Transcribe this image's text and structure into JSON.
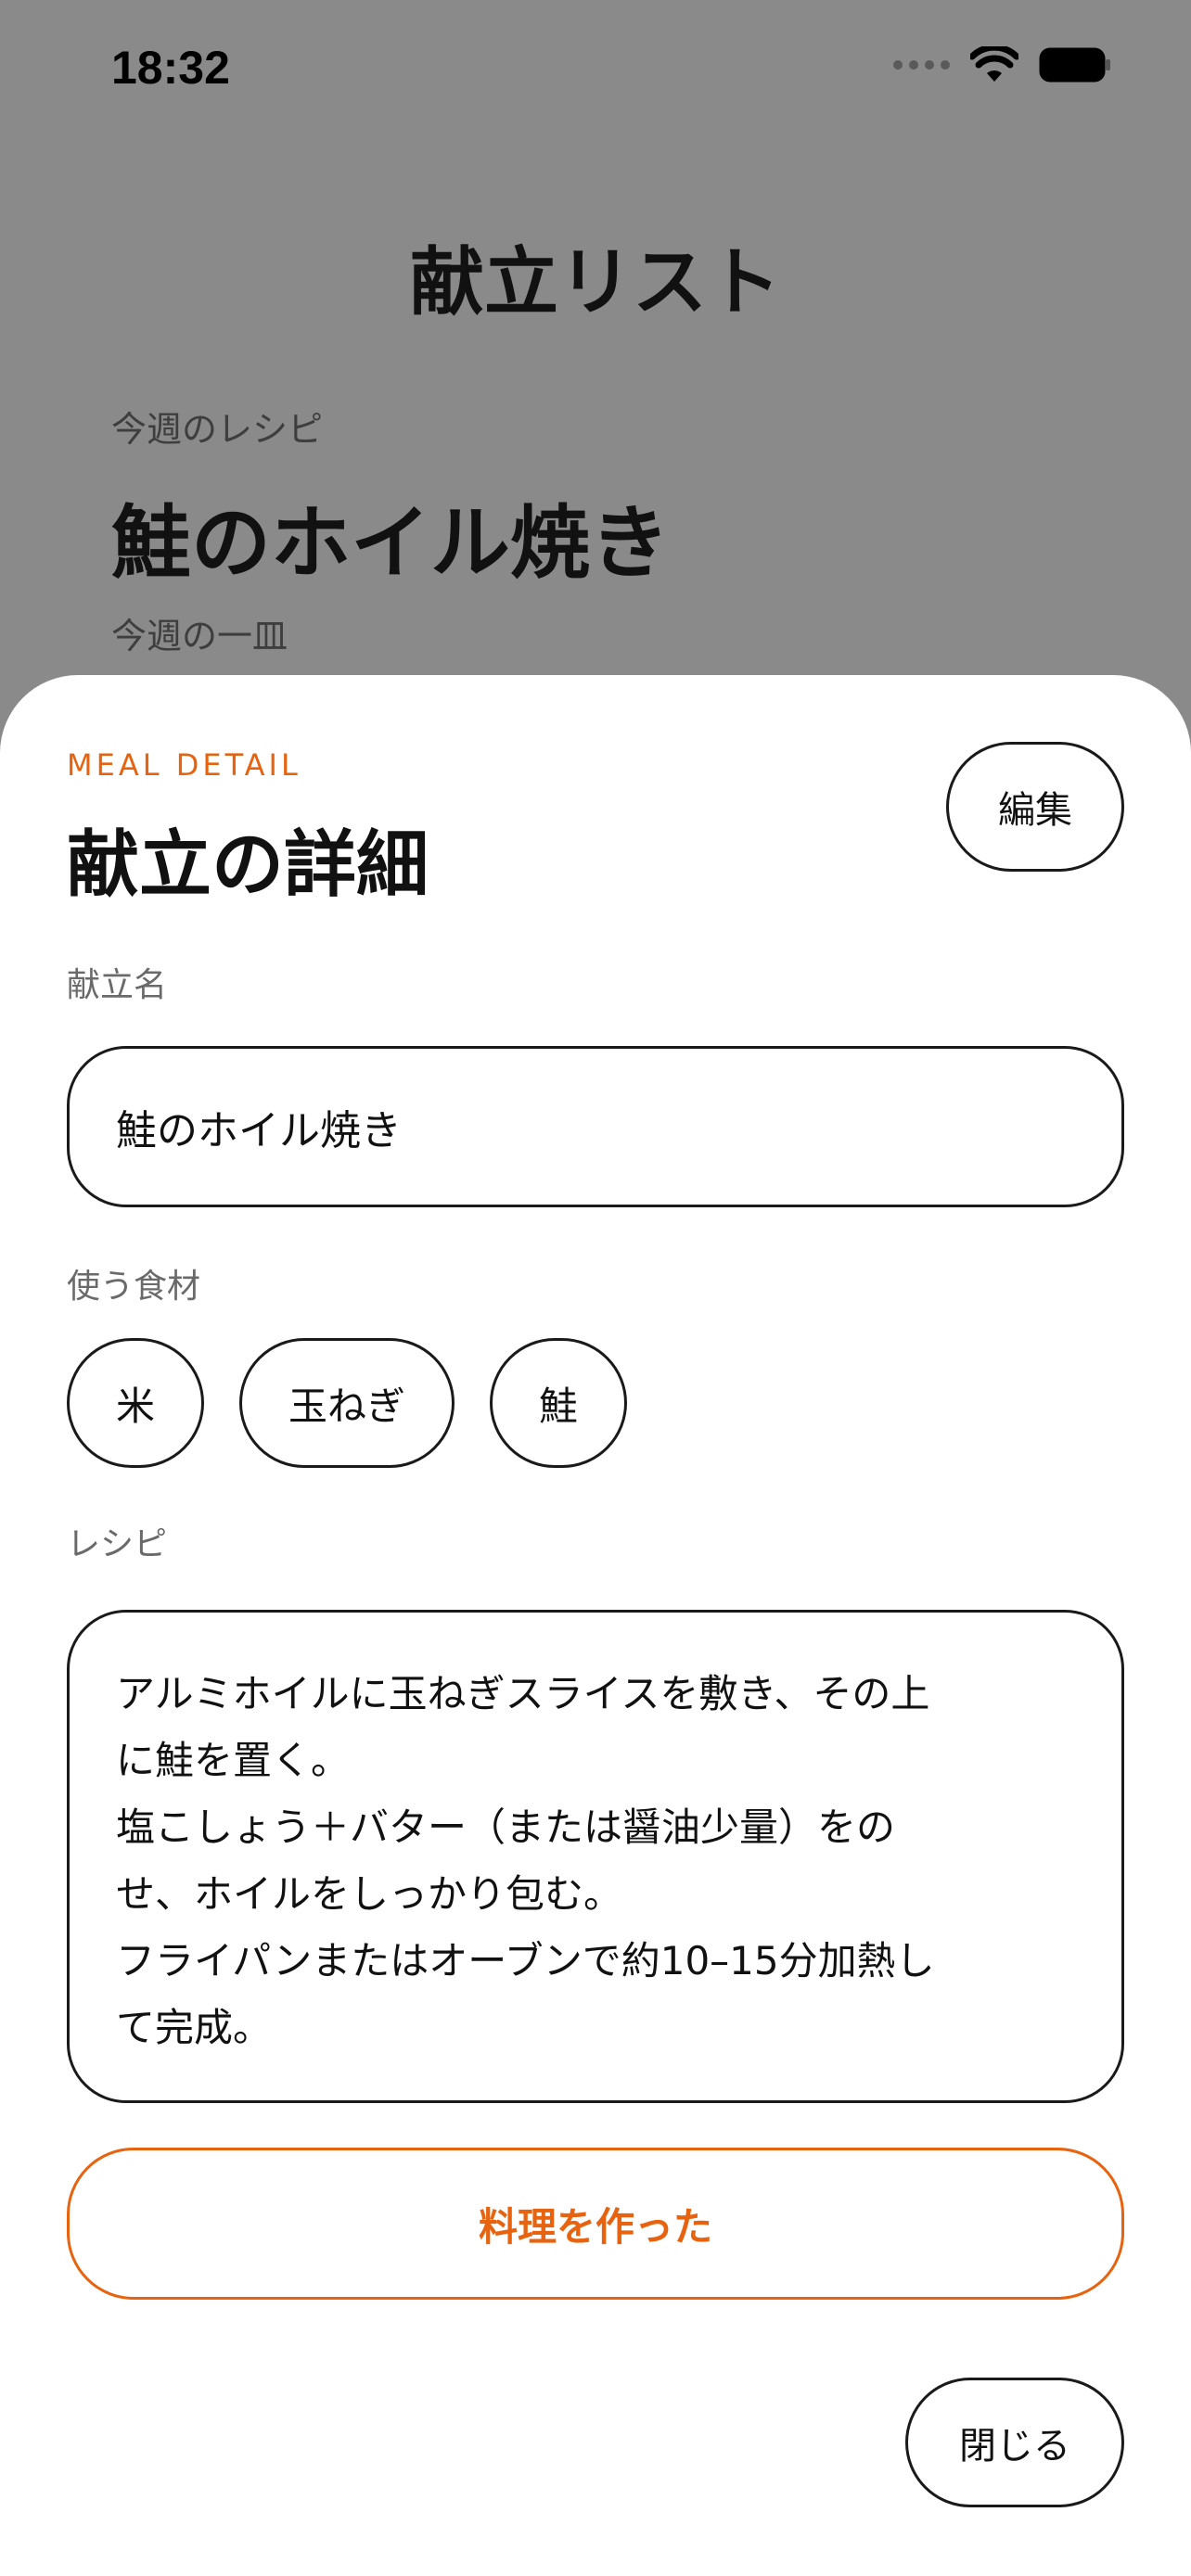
{
  "status_bar": {
    "time": "18:32"
  },
  "background_page": {
    "title": "献立リスト",
    "section_label": "今週のレシピ",
    "dish_name": "鮭のホイル焼き",
    "sub_label": "今週の一皿"
  },
  "sheet": {
    "eyebrow": "MEAL DETAIL",
    "title": "献立の詳細",
    "edit_label": "編集",
    "name_label": "献立名",
    "name_value": "鮭のホイル焼き",
    "ingredients_label": "使う食材",
    "ingredients": [
      "米",
      "玉ねぎ",
      "鮭"
    ],
    "recipe_label": "レシピ",
    "recipe_lines": [
      "アルミホイルに玉ねぎスライスを敷き、その上",
      "に鮭を置く。",
      "塩こしょう＋バター（または醤油少量）をの",
      "せ、ホイルをしっかり包む。",
      "フライパンまたはオーブンで約10–15分加熱し",
      "て完成。"
    ],
    "cook_label": "料理を作った",
    "close_label": "閉じる"
  },
  "colors": {
    "accent": "#e8630f",
    "scrim": "#8a8a8a"
  }
}
